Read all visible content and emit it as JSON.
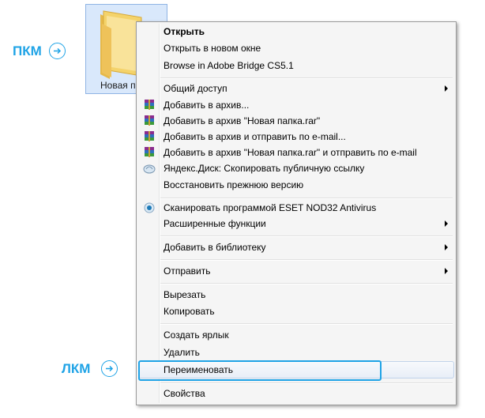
{
  "folder": {
    "label": "Новая п"
  },
  "annotations": {
    "right_click": "ПКМ",
    "left_click": "ЛКМ",
    "accent_color": "#1fa3e6"
  },
  "menu": {
    "items": [
      {
        "label": "Открыть",
        "bold": true
      },
      {
        "label": "Открыть в новом окне"
      },
      {
        "label": "Browse in Adobe Bridge CS5.1"
      },
      {
        "label": "Общий доступ",
        "submenu": true
      },
      {
        "label": "Добавить в архив...",
        "icon": "winrar-icon"
      },
      {
        "label": "Добавить в архив \"Новая папка.rar\"",
        "icon": "winrar-icon"
      },
      {
        "label": "Добавить в архив и отправить по e-mail...",
        "icon": "winrar-icon"
      },
      {
        "label": "Добавить в архив \"Новая папка.rar\" и отправить по e-mail",
        "icon": "winrar-icon"
      },
      {
        "label": "Яндекс.Диск: Скопировать публичную ссылку",
        "icon": "yandex-disk-icon"
      },
      {
        "label": "Восстановить прежнюю версию"
      },
      {
        "label": "Сканировать программой ESET NOD32 Antivirus",
        "icon": "eset-icon"
      },
      {
        "label": "Расширенные функции",
        "submenu": true
      },
      {
        "label": "Добавить в библиотеку",
        "submenu": true
      },
      {
        "label": "Отправить",
        "submenu": true
      },
      {
        "label": "Вырезать"
      },
      {
        "label": "Копировать"
      },
      {
        "label": "Создать ярлык"
      },
      {
        "label": "Удалить"
      },
      {
        "label": "Переименовать",
        "highlighted": true
      },
      {
        "label": "Свойства"
      }
    ]
  }
}
